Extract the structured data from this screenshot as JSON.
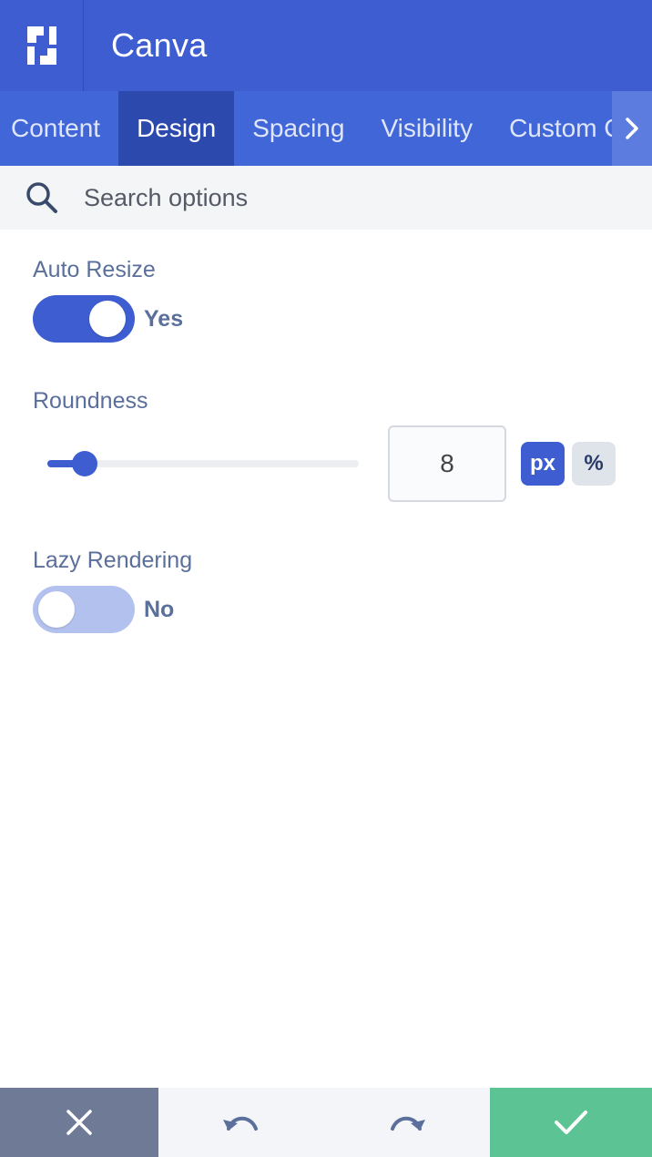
{
  "header": {
    "title": "Canva",
    "logo_icon": "divi-logo-icon"
  },
  "tabs": [
    {
      "label": "Content",
      "active": false
    },
    {
      "label": "Design",
      "active": true
    },
    {
      "label": "Spacing",
      "active": false
    },
    {
      "label": "Visibility",
      "active": false
    },
    {
      "label": "Custom CSS",
      "active": false
    }
  ],
  "tab_scroll_icon": "chevron-right-icon",
  "search": {
    "placeholder": "Search options",
    "value": "",
    "icon": "search-icon"
  },
  "options": {
    "auto_resize": {
      "label": "Auto Resize",
      "state": "Yes",
      "on": true
    },
    "roundness": {
      "label": "Roundness",
      "value": "8",
      "unit_px": "px",
      "unit_percent": "%",
      "active_unit": "px",
      "slider_fraction": 0.12
    },
    "lazy_rendering": {
      "label": "Lazy Rendering",
      "state": "No",
      "on": false
    }
  },
  "footer": {
    "close_icon": "close-icon",
    "undo_icon": "undo-icon",
    "redo_icon": "redo-icon",
    "save_icon": "check-icon"
  },
  "colors": {
    "primary": "#3d5dd1",
    "tab_bar": "#4166d7",
    "tab_active": "#2c49ad",
    "label": "#5a6f9b",
    "save": "#5cc394",
    "close": "#6e7a96"
  }
}
